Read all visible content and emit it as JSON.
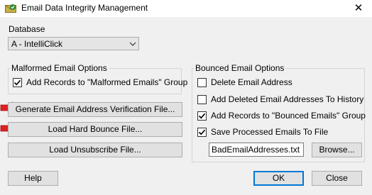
{
  "window": {
    "title": "Email Data Integrity Management",
    "app_icon": "app-icon",
    "close_glyph": "✕"
  },
  "database": {
    "label": "Database",
    "selected": "A - IntelliClick"
  },
  "malformed": {
    "legend": "Malformed Email Options",
    "add_records_label": "Add Records to \"Malformed Emails\" Group",
    "add_records_checked": true
  },
  "buttons": {
    "generate": "Generate Email Address Verification File...",
    "load_hard_bounce": "Load Hard Bounce File...",
    "load_unsubscribe": "Load Unsubscribe File...",
    "help": "Help",
    "ok": "OK",
    "close": "Close",
    "browse": "Browse..."
  },
  "bounced": {
    "legend": "Bounced Email Options",
    "options": [
      {
        "label": "Delete Email Address",
        "checked": false
      },
      {
        "label": "Add Deleted Email Addresses To History",
        "checked": false
      },
      {
        "label": "Add Records to \"Bounced Emails\" Group",
        "checked": true
      },
      {
        "label": "Save Processed Emails To File",
        "checked": true
      }
    ],
    "filename": "BadEmailAddresses.txt"
  },
  "colors": {
    "arrow_red": "#e02020",
    "ok_border": "#0078d7"
  }
}
